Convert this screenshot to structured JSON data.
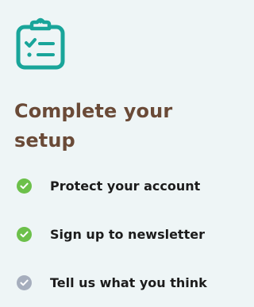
{
  "header": {
    "icon": "clipboard-checklist-icon",
    "title": "Complete your setup",
    "accent_color": "#19a59a",
    "title_color": "#6a4a37"
  },
  "steps": [
    {
      "label": "Protect your account",
      "status": "done",
      "icon": "check-icon",
      "color": "#6cc04a"
    },
    {
      "label": "Sign up to newsletter",
      "status": "done",
      "icon": "check-icon",
      "color": "#6cc04a"
    },
    {
      "label": "Tell us what you think",
      "status": "pending",
      "icon": "check-icon",
      "color": "#a6aebd"
    }
  ]
}
